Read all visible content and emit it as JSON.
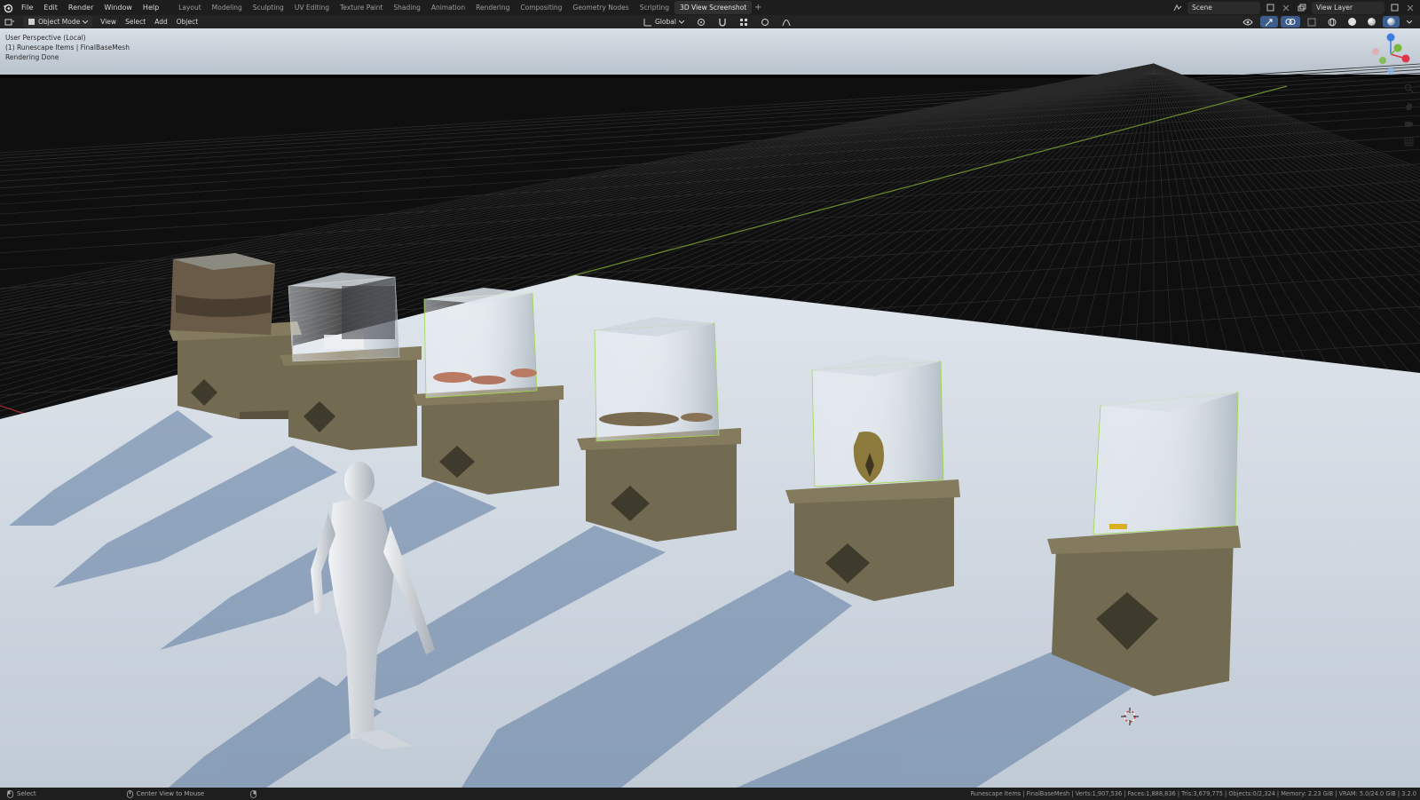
{
  "app_menu": {
    "items": [
      "File",
      "Edit",
      "Render",
      "Window",
      "Help"
    ]
  },
  "workspaces": {
    "tabs": [
      "Layout",
      "Modeling",
      "Sculpting",
      "UV Editing",
      "Texture Paint",
      "Shading",
      "Animation",
      "Rendering",
      "Compositing",
      "Geometry Nodes",
      "Scripting",
      "3D View Screenshot"
    ],
    "active": "3D View Screenshot",
    "add_label": "+"
  },
  "top_right": {
    "scene_label": "Scene",
    "view_layer_label": "View Layer"
  },
  "viewport_header": {
    "mode": "Object Mode",
    "menus": [
      "View",
      "Select",
      "Add",
      "Object"
    ],
    "transform_orientation": "Global"
  },
  "viewport_overlay": {
    "line1": "User Perspective (Local)",
    "line2": "(1) Runescape Items | FinalBaseMesh",
    "line3": "Rendering Done"
  },
  "gizmo": {
    "axes": [
      "X",
      "Y",
      "Z"
    ],
    "colors": {
      "x": "#e2334a",
      "y": "#79b83a",
      "z": "#3b7ee0"
    }
  },
  "nav_tools": [
    "zoom-icon",
    "pan-hand-icon",
    "camera-icon",
    "grid-icon"
  ],
  "status_bar": {
    "left_action": "Select",
    "middle_action": "Center View to Mouse",
    "stats": "Runescape Items | FinalBaseMesh | Verts:1,907,536 | Faces:1,888,836 | Tris:3,679,775 | Objects:0/2,324 | Memory: 2.23 GiB | VRAM: 5.0/24.0 GiB | 3.2.0"
  },
  "colors": {
    "background": "#0d0d0d",
    "floor": "#cdd6e0",
    "pedestal": "#6a6048",
    "glass_outline": "#9fd94a",
    "header": "#232323",
    "topbar": "#1d1d1d"
  }
}
